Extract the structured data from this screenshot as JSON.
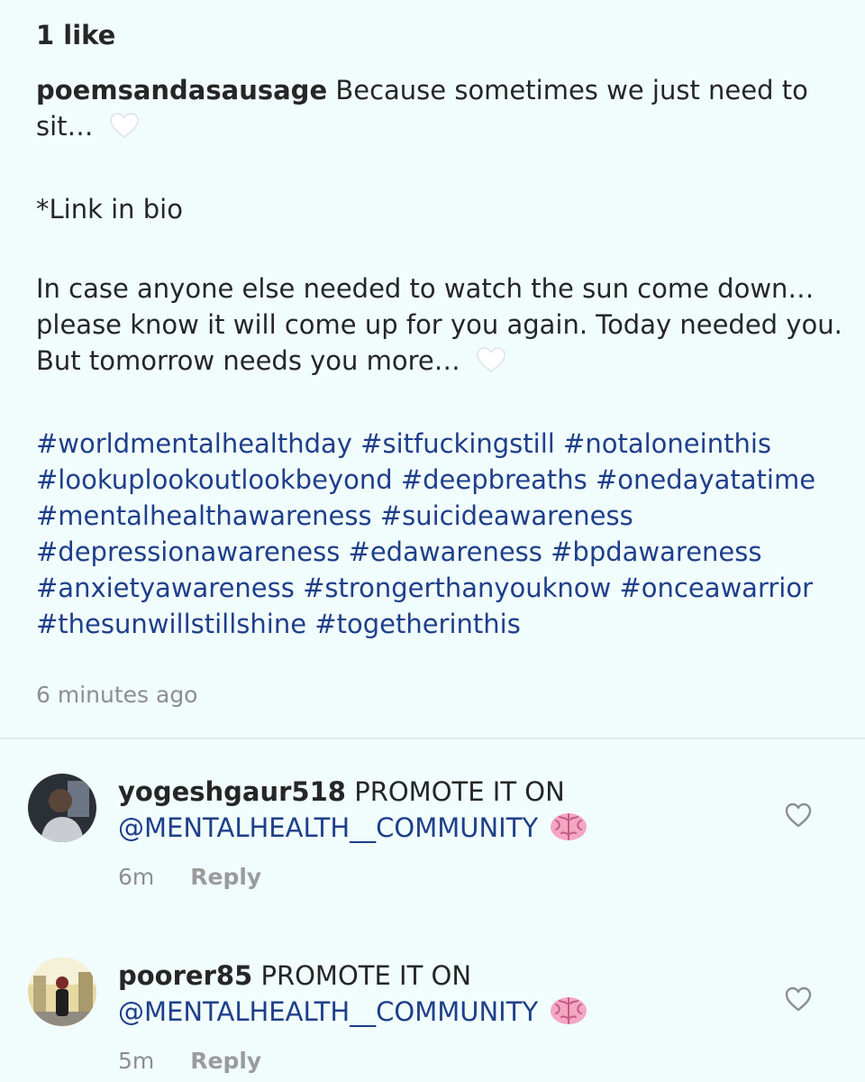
{
  "post": {
    "likes": "1 like",
    "username": "poemsandasausage",
    "caption_line1": " Because sometimes we just need to sit… ",
    "caption_link": "*Link in bio",
    "caption_body": "In case anyone else needed to watch the sun come down…please know it will come up for you again. Today needed you. But tomorrow needs you more… ",
    "hashtags": "#worldmentalhealthday #sitfuckingstill #notaloneinthis #lookuplookoutlookbeyond #deepbreaths #onedayatatime #mentalhealthawareness #suicideawareness #depressionawareness #edawareness #bpdawareness #anxietyawareness #strongerthanyouknow #onceawarrior #thesunwillstillshine #togetherinthis",
    "timestamp": "6 minutes ago"
  },
  "comments": [
    {
      "username": "yogeshgaur518",
      "text": " PROMOTE IT ON ",
      "mention": "@MENTALHEALTH__COMMUNITY",
      "time": "6m",
      "reply_label": "Reply"
    },
    {
      "username": "poorer85",
      "text": " PROMOTE IT ON ",
      "mention": "@MENTALHEALTH__COMMUNITY",
      "time": "5m",
      "reply_label": "Reply"
    }
  ],
  "icons": {
    "white_heart_emoji": "white-heart",
    "brain_emoji": "brain",
    "like_heart": "heart-outline"
  },
  "colors": {
    "background": "#f1fcfd",
    "text": "#262626",
    "link": "#1e3f8a",
    "muted": "#8e8e8e"
  }
}
